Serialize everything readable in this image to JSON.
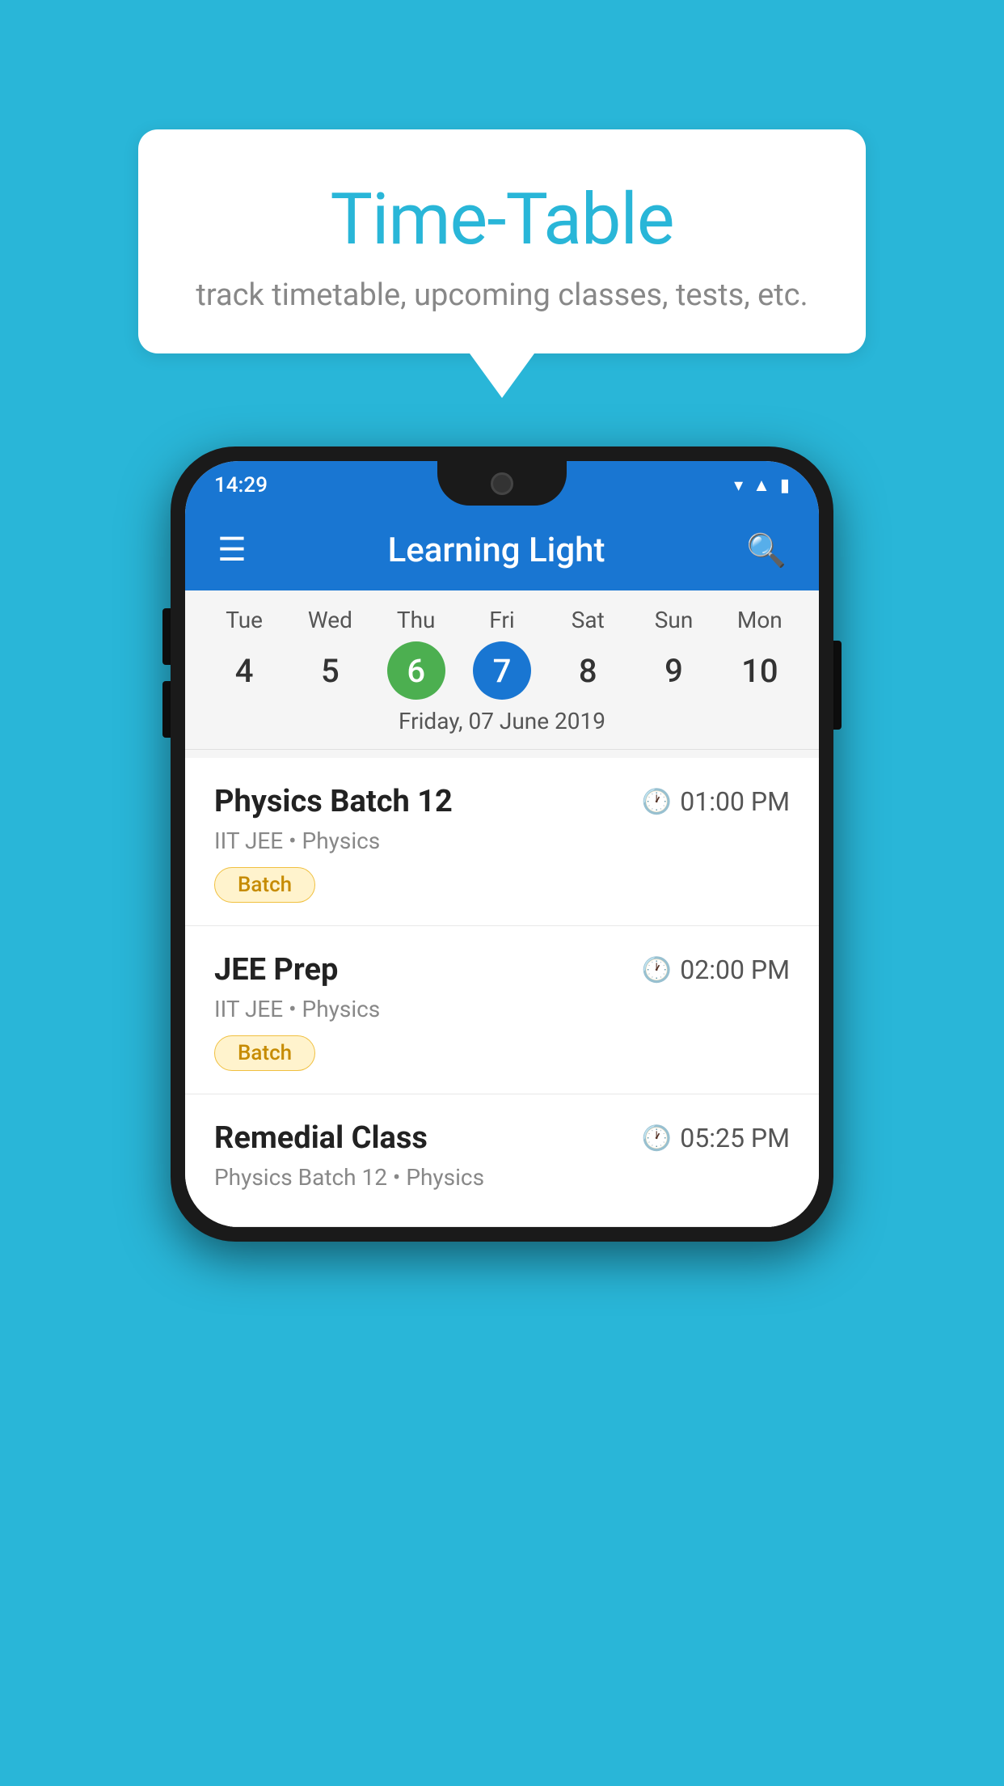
{
  "background_color": "#29B6D8",
  "speech_bubble": {
    "title": "Time-Table",
    "subtitle": "track timetable, upcoming classes, tests, etc."
  },
  "phone": {
    "status_bar": {
      "time": "14:29"
    },
    "app_bar": {
      "title": "Learning Light"
    },
    "calendar": {
      "days": [
        {
          "name": "Tue",
          "number": "4",
          "state": "normal"
        },
        {
          "name": "Wed",
          "number": "5",
          "state": "normal"
        },
        {
          "name": "Thu",
          "number": "6",
          "state": "today"
        },
        {
          "name": "Fri",
          "number": "7",
          "state": "selected"
        },
        {
          "name": "Sat",
          "number": "8",
          "state": "normal"
        },
        {
          "name": "Sun",
          "number": "9",
          "state": "normal"
        },
        {
          "name": "Mon",
          "number": "10",
          "state": "normal"
        }
      ],
      "selected_date_label": "Friday, 07 June 2019"
    },
    "schedule": [
      {
        "title": "Physics Batch 12",
        "time": "01:00 PM",
        "meta": "IIT JEE • Physics",
        "tag": "Batch"
      },
      {
        "title": "JEE Prep",
        "time": "02:00 PM",
        "meta": "IIT JEE • Physics",
        "tag": "Batch"
      },
      {
        "title": "Remedial Class",
        "time": "05:25 PM",
        "meta": "Physics Batch 12 • Physics",
        "tag": ""
      }
    ]
  }
}
